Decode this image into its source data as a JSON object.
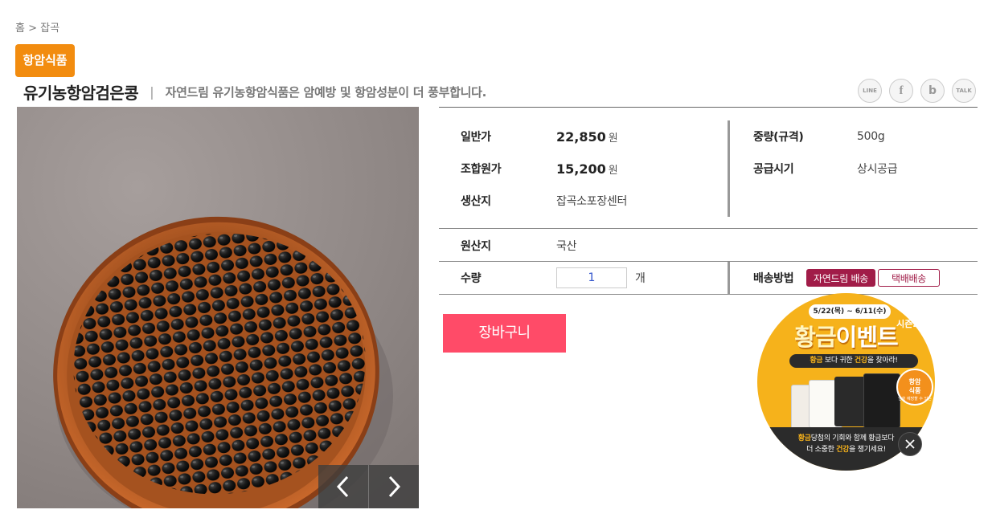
{
  "breadcrumb": {
    "home": "홈",
    "separator": ">",
    "current": "잡곡"
  },
  "category_badge": "항암식품",
  "product": {
    "name": "유기농항암검은콩",
    "separator": "|",
    "description": "자연드림 유기농항암식품은 암예방 및 항암성분이 더 풍부합니다."
  },
  "share": [
    {
      "label": "LINE",
      "icon": "line-icon"
    },
    {
      "label": "f",
      "icon": "facebook-icon"
    },
    {
      "label": "b",
      "icon": "band-icon"
    },
    {
      "label": "TALK",
      "icon": "kakaotalk-icon"
    }
  ],
  "info": {
    "regular_price_label": "일반가",
    "regular_price": "22,850",
    "member_price_label": "조합원가",
    "member_price": "15,200",
    "currency": "원",
    "producer_label": "생산지",
    "producer": "잡곡소포장센터",
    "weight_label": "중량(규격)",
    "weight": "500g",
    "supply_label": "공급시기",
    "supply": "상시공급",
    "origin_label": "원산지",
    "origin": "국산",
    "quantity_label": "수량",
    "quantity": "1",
    "quantity_unit": "개",
    "shipping_label": "배송방법",
    "shipping_options": [
      "자연드림 배송",
      "택배배송"
    ],
    "shipping_selected": "자연드림 배송"
  },
  "cart_button": "장바구니",
  "promo": {
    "dates": "5/22(목) ~ 6/11(수)",
    "season": "시즌2",
    "title_part1": "황금",
    "title_part2": "이벤트",
    "subtitle_1": "황금",
    "subtitle_2": "보다 귀한",
    "subtitle_3": "건강",
    "subtitle_4": "을 찾아라!",
    "badge_line1": "항암",
    "badge_line2": "식품",
    "badge_small": "암을 예방할 수 있는",
    "bottom_1": "황금",
    "bottom_2": "당첨의 기회와 함께 황금보다",
    "bottom_3": "더 소중한",
    "bottom_4": "건강",
    "bottom_5": "을 챙기세요!"
  },
  "colors": {
    "badge": "#f28c0f",
    "cart": "#ff4b68",
    "shipping_accent": "#a11c48",
    "promo_gold": "#f6b21b"
  }
}
